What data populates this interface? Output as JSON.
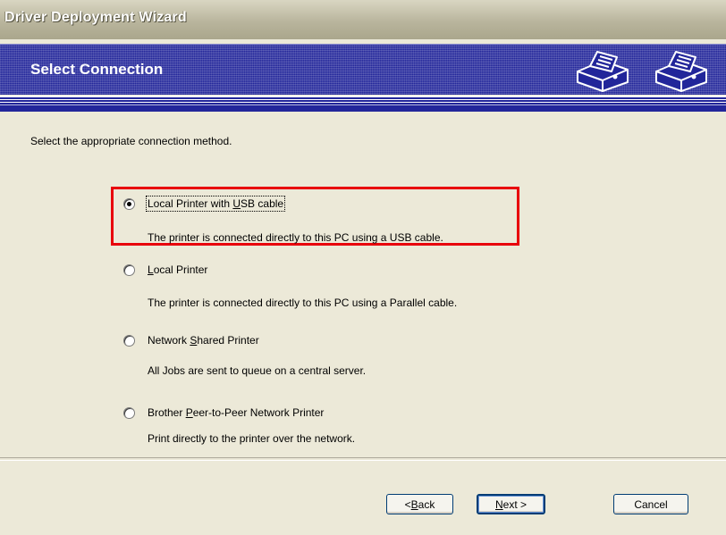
{
  "window": {
    "title": "Driver Deployment Wizard"
  },
  "banner": {
    "heading": "Select Connection",
    "icons": [
      "printer-icon",
      "printer-icon"
    ]
  },
  "instruction": "Select the appropriate connection method.",
  "options": [
    {
      "label_pre": "Local Printer with ",
      "label_key": "U",
      "label_post": "SB cable",
      "description": "The printer is connected directly to this PC using a USB cable.",
      "selected": true
    },
    {
      "label_pre": "",
      "label_key": "L",
      "label_post": "ocal Printer",
      "description": "The printer is connected directly to this PC using a Parallel cable.",
      "selected": false
    },
    {
      "label_pre": "Network ",
      "label_key": "S",
      "label_post": "hared Printer",
      "description": "All Jobs are sent to queue on a central server.",
      "selected": false
    },
    {
      "label_pre": "Brother ",
      "label_key": "P",
      "label_post": "eer-to-Peer Network Printer",
      "description": "Print directly to the printer over the network.",
      "selected": false
    }
  ],
  "buttons": {
    "back": {
      "pre": "< ",
      "key": "B",
      "post": "ack"
    },
    "next": {
      "pre": "",
      "key": "N",
      "post": "ext >"
    },
    "cancel": "Cancel"
  },
  "colors": {
    "banner": "#22269a",
    "highlight": "#e8000c",
    "dialog": "#ece9d8"
  }
}
